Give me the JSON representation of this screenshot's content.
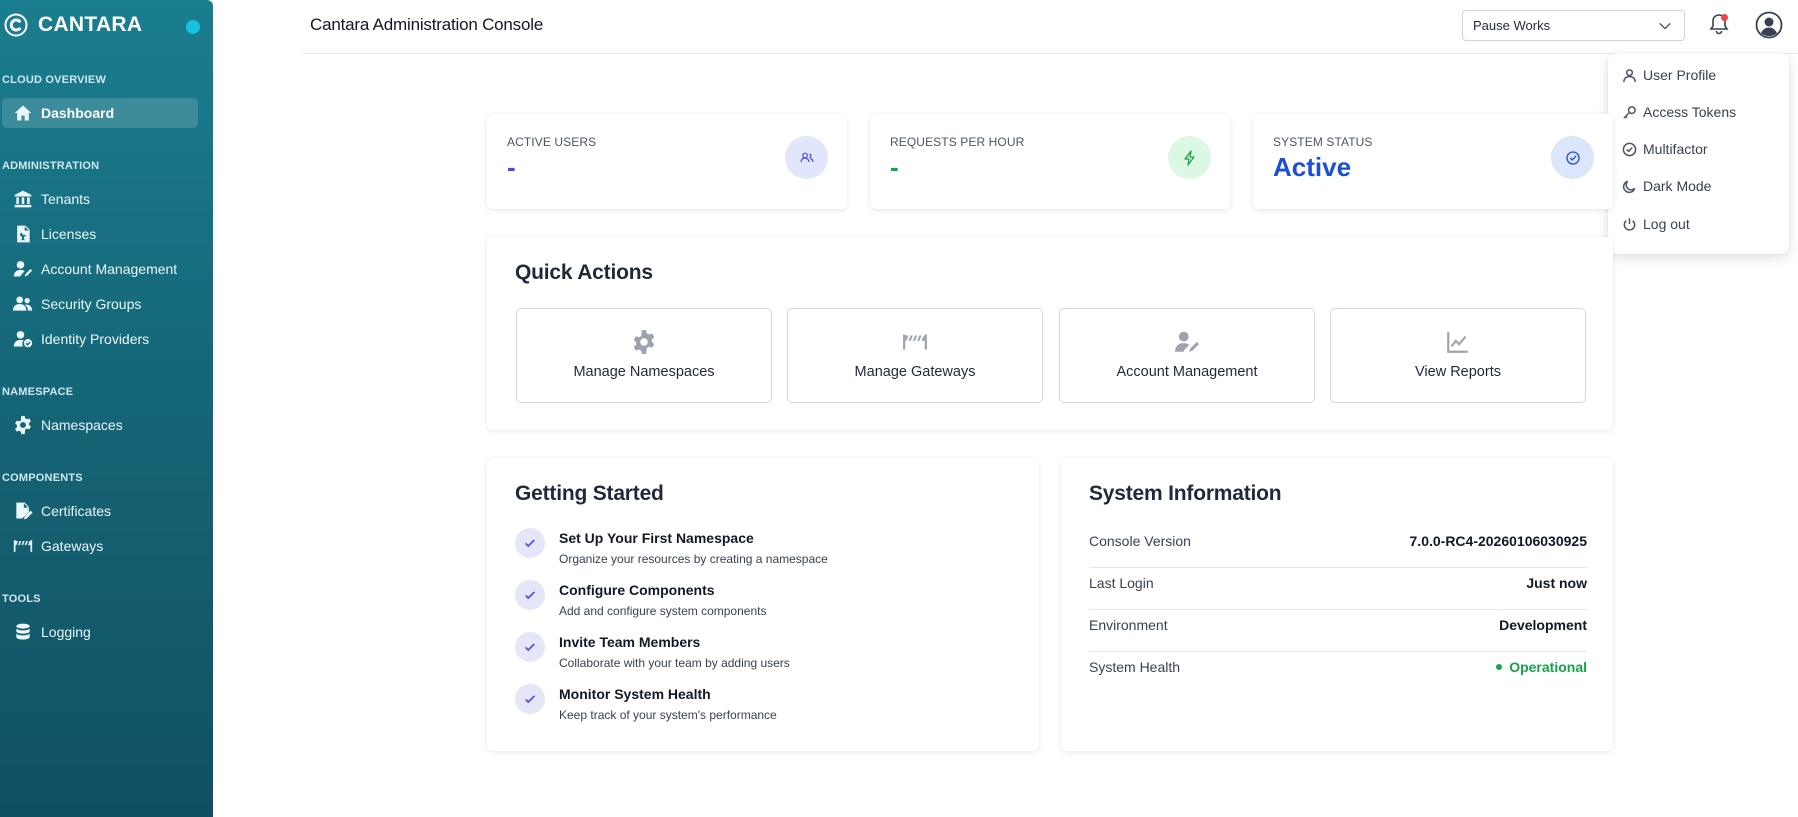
{
  "sidebar": {
    "brand": "CANTARA",
    "sections": {
      "cloud_overview": "CLOUD OVERVIEW",
      "administration": "ADMINISTRATION",
      "namespace": "NAMESPACE",
      "components": "COMPONENTS",
      "tools": "TOOLS"
    },
    "items": [
      {
        "label": "Dashboard",
        "icon": "home-icon",
        "active": true
      },
      {
        "label": "Tenants",
        "icon": "building-icon"
      },
      {
        "label": "Licenses",
        "icon": "license-file-icon"
      },
      {
        "label": "Account Management",
        "icon": "user-edit-icon"
      },
      {
        "label": "Security Groups",
        "icon": "users-icon"
      },
      {
        "label": "Identity Providers",
        "icon": "user-check-icon"
      },
      {
        "label": "Namespaces",
        "icon": "gear-icon"
      },
      {
        "label": "Certificates",
        "icon": "certificate-icon"
      },
      {
        "label": "Gateways",
        "icon": "gateway-barrier-icon"
      },
      {
        "label": "Logging",
        "icon": "database-icon"
      }
    ],
    "accent_dot_color": "#16c1de"
  },
  "header": {
    "title": "Cantara Administration Console",
    "namespace_select": {
      "value": "Pause Works"
    }
  },
  "user_menu": {
    "items": [
      {
        "label": "User Profile",
        "icon": "user-icon"
      },
      {
        "label": "Access Tokens",
        "icon": "key-icon"
      },
      {
        "label": "Multifactor",
        "icon": "check-circle-icon"
      },
      {
        "label": "Dark Mode",
        "icon": "moon-icon"
      },
      {
        "label": "Log out",
        "icon": "power-icon"
      }
    ]
  },
  "stats": [
    {
      "label": "ACTIVE USERS",
      "value": "-",
      "color": "#4f46e5",
      "icon": "users-icon",
      "icon_bg": "#e2e6fb"
    },
    {
      "label": "REQUESTS PER HOUR",
      "value": "-",
      "color": "#16a34a",
      "icon": "lightning-icon",
      "icon_bg": "#dcf7e4"
    },
    {
      "label": "SYSTEM STATUS",
      "value": "Active",
      "color": "#1d4ed8",
      "icon": "check-badge-icon",
      "icon_bg": "#dbe6fb"
    }
  ],
  "quick_actions": {
    "title": "Quick Actions",
    "items": [
      {
        "label": "Manage Namespaces",
        "icon": "gear-icon"
      },
      {
        "label": "Manage Gateways",
        "icon": "gateway-barrier-icon"
      },
      {
        "label": "Account Management",
        "icon": "user-edit-icon"
      },
      {
        "label": "View Reports",
        "icon": "chart-line-icon"
      }
    ]
  },
  "getting_started": {
    "title": "Getting Started",
    "items": [
      {
        "title": "Set Up Your First Namespace",
        "desc": "Organize your resources by creating a namespace"
      },
      {
        "title": "Configure Components",
        "desc": "Add and configure system components"
      },
      {
        "title": "Invite Team Members",
        "desc": "Collaborate with your team by adding users"
      },
      {
        "title": "Monitor System Health",
        "desc": "Keep track of your system's performance"
      }
    ]
  },
  "system_info": {
    "title": "System Information",
    "rows": [
      {
        "key": "Console Version",
        "value": "7.0.0-RC4-20260106030925"
      },
      {
        "key": "Last Login",
        "value": "Just now"
      },
      {
        "key": "Environment",
        "value": "Development"
      },
      {
        "key": "System Health",
        "value": "Operational",
        "status_color": "#16a34a"
      }
    ]
  }
}
